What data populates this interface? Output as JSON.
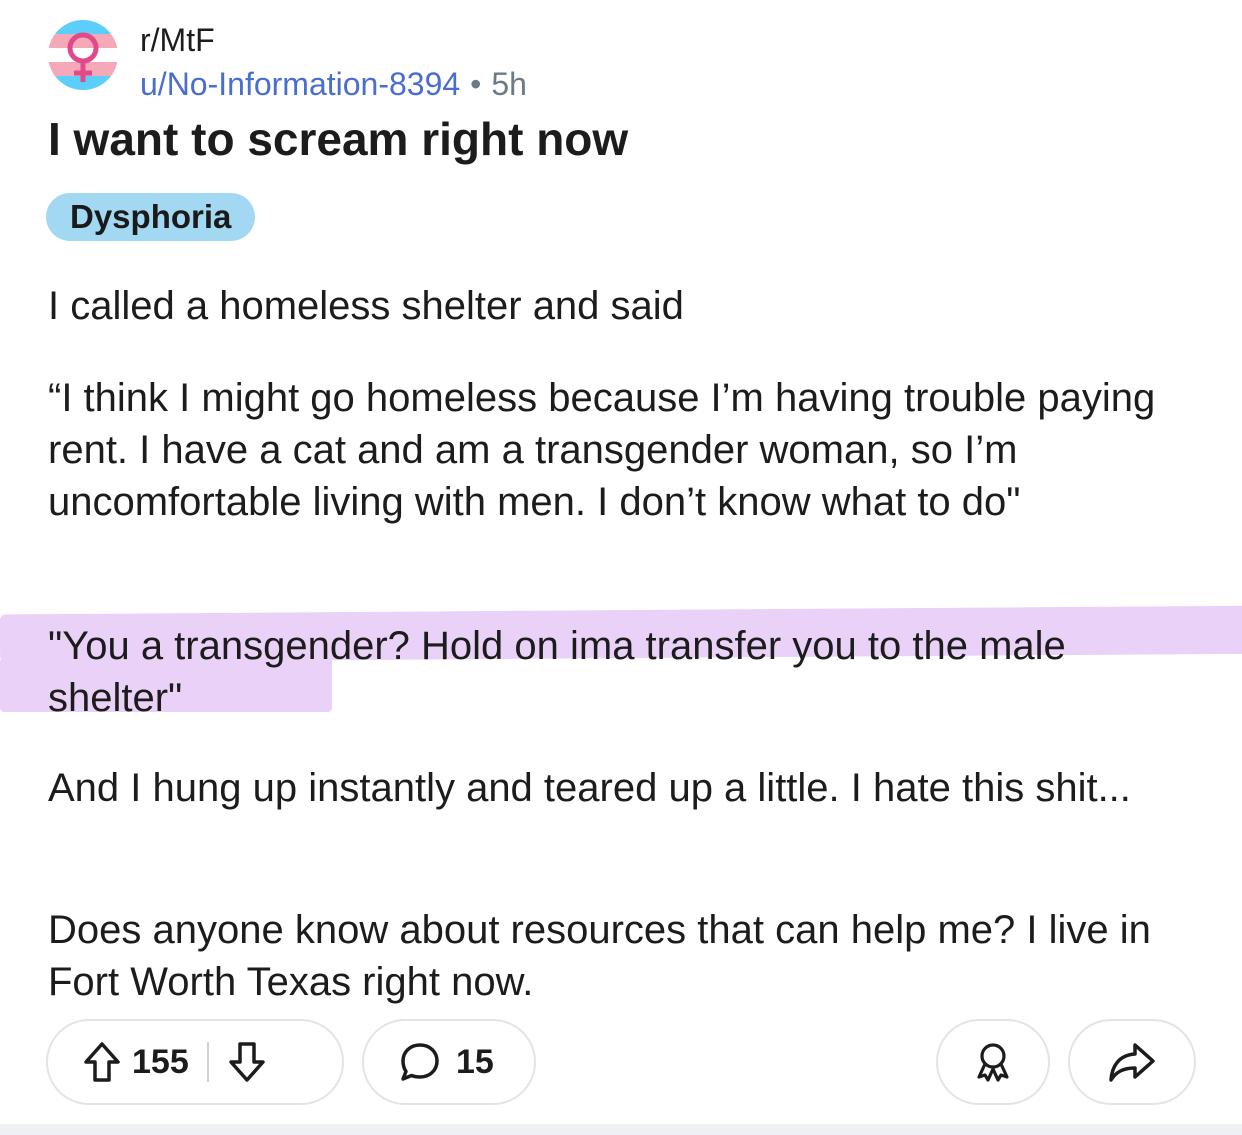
{
  "post": {
    "subreddit": "r/MtF",
    "author": "u/No-Information-8394",
    "separator": "•",
    "age": "5h",
    "title": "I want to scream right now",
    "flair": "Dysphoria",
    "paragraphs": [
      "I called a homeless shelter and said",
      "“I think I might go homeless because I’m having trouble paying rent. I have a cat and am a transgender woman, so I’m uncomfortable living with men. I don’t know what to do\"",
      "\"You a transgender? Hold on ima transfer you to the male shelter\"",
      "And I hung up instantly and teared up a little. I hate this shit...",
      "Does anyone know about resources that can help me? I live in Fort Worth Texas right now."
    ]
  },
  "actions": {
    "upvotes": "155",
    "comments": "15"
  },
  "icons": {
    "avatar": "trans-symbol-icon",
    "upvote": "arrow-up-icon",
    "downvote": "arrow-down-icon",
    "comment": "speech-bubble-icon",
    "award": "award-icon",
    "share": "share-icon"
  },
  "colors": {
    "username": "#4a6dd1",
    "flair_bg": "#a2d8f2",
    "highlight": "#ead1f7",
    "trans_blue": "#5bcefa",
    "trans_pink": "#f5a9b8"
  }
}
